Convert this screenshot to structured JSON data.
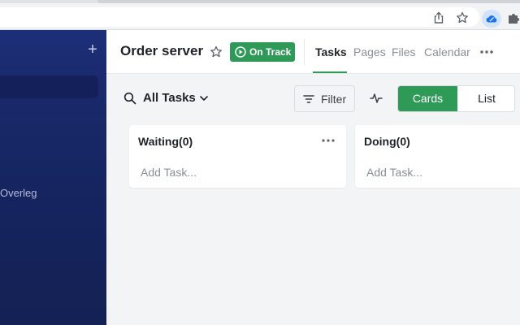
{
  "colors": {
    "accent": "#2f9a58",
    "sidebar": "#15245e",
    "canvas": "#f3f4f6"
  },
  "sidebar": {
    "add_icon": "plus-icon",
    "items": [
      {
        "label": "Overleg"
      }
    ]
  },
  "header": {
    "project_title": "Order server",
    "favorite_icon": "star-icon",
    "status": {
      "label": "On Track",
      "icon": "play-circle-icon"
    },
    "tabs": [
      {
        "label": "Tasks",
        "active": true
      },
      {
        "label": "Pages",
        "active": false
      },
      {
        "label": "Files",
        "active": false
      },
      {
        "label": "Calendar",
        "active": false
      }
    ],
    "more_icon": "more-horizontal-icon"
  },
  "toolbar": {
    "view_select": {
      "label": "All Tasks",
      "icon": "search-icon",
      "chevron": "chevron-down-icon"
    },
    "filter": {
      "label": "Filter",
      "icon": "filter-lines-icon"
    },
    "activity_icon": "activity-pulse-icon",
    "view_toggle": [
      {
        "label": "Cards",
        "selected": true
      },
      {
        "label": "List",
        "selected": false
      }
    ]
  },
  "columns": [
    {
      "title": "Waiting(0)",
      "add_label": "Add Task..."
    },
    {
      "title": "Doing(0)",
      "add_label": "Add Task..."
    }
  ]
}
